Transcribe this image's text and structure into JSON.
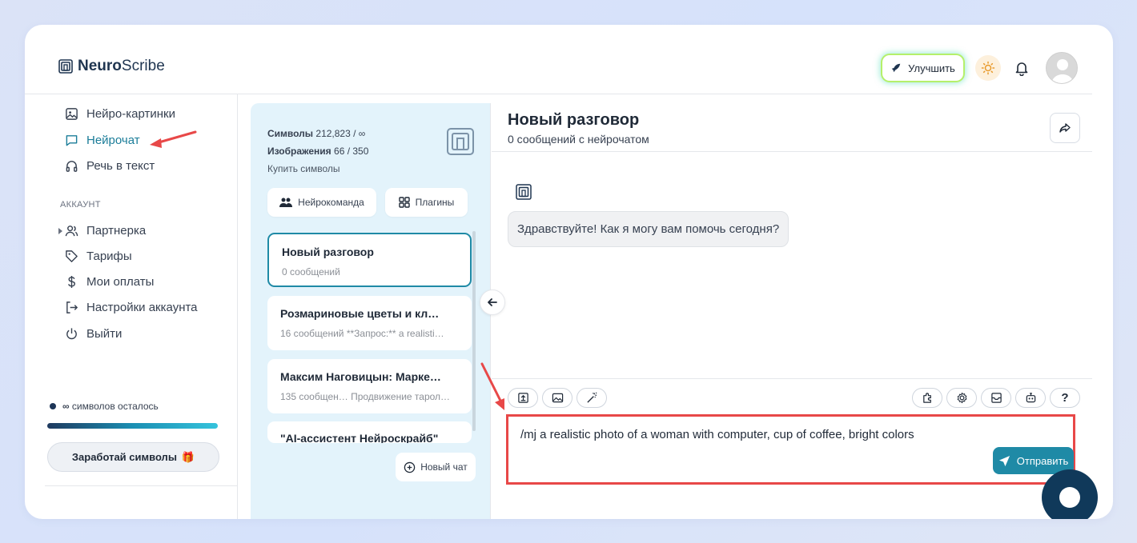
{
  "app": {
    "brand_bold": "Neuro",
    "brand_regular": "Scribe"
  },
  "header": {
    "upgrade_label": "Улучшить"
  },
  "sidebar": {
    "items": [
      {
        "label": "Нейро-картинки",
        "icon": "image-icon"
      },
      {
        "label": "Нейрочат",
        "icon": "chat-icon",
        "active": true
      },
      {
        "label": "Речь в текст",
        "icon": "headphones-icon"
      }
    ],
    "section_title": "АККАУНТ",
    "account_items": [
      {
        "label": "Партнерка",
        "icon": "users-icon"
      },
      {
        "label": "Тарифы",
        "icon": "tag-icon"
      },
      {
        "label": "Мои оплаты",
        "icon": "dollar-icon"
      },
      {
        "label": "Настройки аккаунта",
        "icon": "settings-exit-icon"
      },
      {
        "label": "Выйти",
        "icon": "power-icon"
      }
    ],
    "remaining_symbol": "∞",
    "remaining_label": "символов осталось",
    "earn_label": "Заработай символы",
    "earn_icon": "🎁"
  },
  "chat_list": {
    "symbols_label": "Символы",
    "symbols_value": "212,823 / ∞",
    "images_label": "Изображения",
    "images_value": "66 / 350",
    "buy_label": "Купить символы",
    "team_button": "Нейрокоманда",
    "plugins_button": "Плагины",
    "chats": [
      {
        "title": "Новый разговор",
        "meta": "0 сообщений",
        "active": true
      },
      {
        "title": "Розмариновые цветы и кл…",
        "meta": "16 сообщений  **Запрос:** a realisti…"
      },
      {
        "title": "Максим Наговицын: Марке…",
        "meta": "135 сообщен… Продвижение тарол…"
      },
      {
        "title": "\"AI-ассистент Нейроскрайб\"",
        "meta": ""
      }
    ],
    "new_chat_label": "Новый чат"
  },
  "chat": {
    "title": "Новый разговор",
    "subtitle": "0 сообщений с нейрочатом",
    "greeting": "Здравствуйте! Как я могу вам помочь сегодня?",
    "input_value": "/mj a realistic photo of a woman with computer, cup of coffee, bright colors",
    "send_label": "Отправить",
    "help_label": "?"
  },
  "colors": {
    "accent": "#1f8aa6",
    "annotation": "#e84848"
  }
}
